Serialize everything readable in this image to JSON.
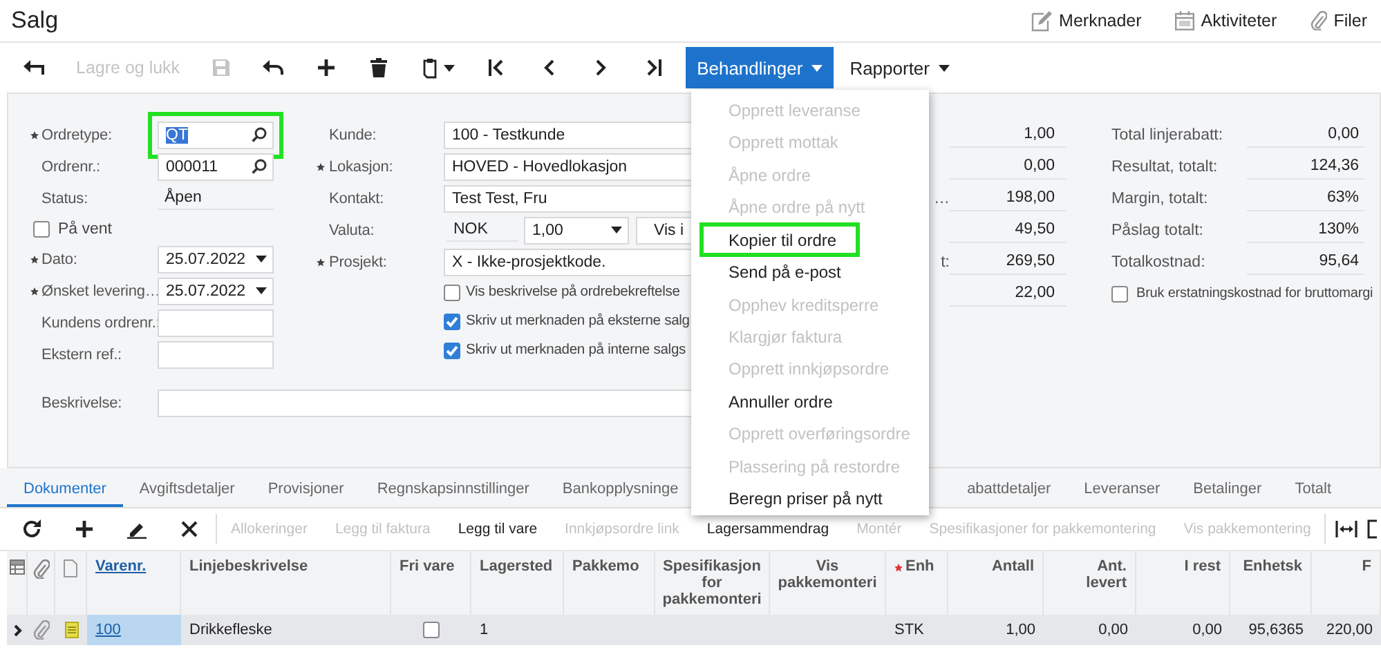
{
  "page_title": "Salg",
  "header_links": [
    {
      "kind": "notes",
      "label": "Merknader"
    },
    {
      "kind": "activities",
      "label": "Aktiviteter"
    },
    {
      "kind": "files",
      "label": "Filer"
    }
  ],
  "toolbar": [
    {
      "kind": "back",
      "disabled": false
    },
    {
      "kind": "text",
      "label": "Lagre og lukk",
      "disabled": true
    },
    {
      "kind": "save",
      "disabled": true
    },
    {
      "kind": "undo",
      "disabled": false
    },
    {
      "kind": "add",
      "disabled": false
    },
    {
      "kind": "delete",
      "disabled": false
    },
    {
      "kind": "clipboard",
      "disabled": false
    },
    {
      "kind": "first",
      "disabled": false
    },
    {
      "kind": "previous",
      "disabled": false
    },
    {
      "kind": "next",
      "disabled": false
    },
    {
      "kind": "last",
      "disabled": false
    }
  ],
  "menus": [
    {
      "label": "Behandlinger",
      "open": true,
      "items": [
        {
          "label": "Opprett leveranse",
          "disabled": true,
          "highlighted": false
        },
        {
          "label": "Opprett mottak",
          "disabled": true,
          "highlighted": false
        },
        {
          "label": "Åpne ordre",
          "disabled": true,
          "highlighted": false
        },
        {
          "label": "Åpne ordre på nytt",
          "disabled": true,
          "highlighted": false
        },
        {
          "label": "Kopier til ordre",
          "disabled": false,
          "highlighted": true
        },
        {
          "label": "Send på e-post",
          "disabled": false,
          "highlighted": false
        },
        {
          "label": "Opphev kreditsperre",
          "disabled": true,
          "highlighted": false
        },
        {
          "label": "Klargjør faktura",
          "disabled": true,
          "highlighted": false
        },
        {
          "label": "Opprett innkjøpsordre",
          "disabled": true,
          "highlighted": false
        },
        {
          "label": "Annuller ordre",
          "disabled": false,
          "highlighted": false
        },
        {
          "label": "Opprett overføringsordre",
          "disabled": true,
          "highlighted": false
        },
        {
          "label": "Plassering på restordre",
          "disabled": true,
          "highlighted": false
        },
        {
          "label": "Beregn priser på nytt",
          "disabled": false,
          "highlighted": false
        }
      ]
    },
    {
      "label": "Rapporter",
      "open": false
    }
  ],
  "form": {
    "left_fields": [
      {
        "kind": "lookup",
        "label": "Ordretype:",
        "required": true,
        "value": "QT",
        "value_selected": true,
        "highlighted": true
      },
      {
        "kind": "lookup",
        "label": "Ordrenr.:",
        "required": false,
        "value": "000011",
        "value_selected": false,
        "highlighted": false
      },
      {
        "kind": "readonly",
        "label": "Status:",
        "required": false,
        "value": "Åpen",
        "value_selected": false,
        "highlighted": false
      },
      {
        "kind": "checkbox",
        "label": "På vent",
        "checked": false,
        "highlighted": false
      },
      {
        "kind": "date",
        "label": "Dato:",
        "required": true,
        "value": "25.07.2022",
        "value_selected": false,
        "highlighted": false
      },
      {
        "kind": "date",
        "label": "Ønsket levering…",
        "required": true,
        "value": "25.07.2022",
        "value_selected": false,
        "highlighted": false
      },
      {
        "kind": "text",
        "label": "Kundens ordrenr.:",
        "required": false,
        "highlighted": false
      },
      {
        "kind": "text",
        "label": "Ekstern ref.:",
        "required": false,
        "highlighted": false
      }
    ],
    "middle_fields": [
      {
        "kind": "wide",
        "label": "Kunde:",
        "required": false,
        "value": "100 - Testkunde"
      },
      {
        "kind": "wide",
        "label": "Lokasjon:",
        "required": true,
        "value": "HOVED - Hovedlokasjon"
      },
      {
        "kind": "wide",
        "label": "Kontakt:",
        "required": false,
        "value": "Test Test, Fru"
      },
      {
        "kind": "currency",
        "label": "Valuta:",
        "required": false,
        "value": "NOK",
        "rate": "1,00",
        "button": "Vis i"
      },
      {
        "kind": "wide",
        "label": "Prosjekt:",
        "required": true,
        "value": "X - Ikke-prosjektkode."
      },
      {
        "kind": "checkbox",
        "label": "Vis beskrivelse på ordrebekreftelse",
        "checked": false
      },
      {
        "kind": "checkbox",
        "label": "Skriv ut merknaden på eksterne salg",
        "checked": true
      },
      {
        "kind": "checkbox",
        "label": "Skriv ut merknaden på interne salgs",
        "checked": true
      }
    ],
    "description": {
      "label": "Beskrivelse:"
    }
  },
  "summary": {
    "middle": [
      {
        "value": "1,00"
      },
      {
        "value": "0,00"
      },
      {
        "label": "…",
        "value": "198,00"
      },
      {
        "value": "49,50"
      },
      {
        "label": "t:",
        "value": "269,50"
      },
      {
        "value": "22,00"
      }
    ],
    "right": [
      {
        "label": "Total linjerabatt:",
        "value": "0,00"
      },
      {
        "label": "Resultat, totalt:",
        "value": "124,36"
      },
      {
        "label": "Margin, totalt:",
        "value": "63%"
      },
      {
        "label": "Påslag totalt:",
        "value": "130%"
      },
      {
        "label": "Totalkostnad:",
        "value": "95,64"
      }
    ],
    "right_checkbox": {
      "label": "Bruk erstatningskostnad for bruttomargi",
      "checked": false
    }
  },
  "tabs": [
    {
      "label": "Dokumenter",
      "selected": true
    },
    {
      "label": "Avgiftsdetaljer",
      "selected": false
    },
    {
      "label": "Provisjoner",
      "selected": false
    },
    {
      "label": "Regnskapsinnstillinger",
      "selected": false
    },
    {
      "label": "Bankopplysninge",
      "selected": false
    },
    {
      "label": "abattdetaljer",
      "selected": false
    },
    {
      "label": "Leveranser",
      "selected": false
    },
    {
      "label": "Betalinger",
      "selected": false
    },
    {
      "label": "Totalt",
      "selected": false
    }
  ],
  "grid_toolbar": [
    {
      "kind": "refresh",
      "disabled": false
    },
    {
      "kind": "add",
      "disabled": false
    },
    {
      "kind": "edit",
      "disabled": false
    },
    {
      "kind": "delete",
      "disabled": false
    },
    {
      "kind": "text",
      "label": "Allokeringer",
      "disabled": true
    },
    {
      "kind": "text",
      "label": "Legg til faktura",
      "disabled": true
    },
    {
      "kind": "text",
      "label": "Legg til vare",
      "disabled": false
    },
    {
      "kind": "text",
      "label": "Innkjøpsordre link",
      "disabled": true
    },
    {
      "kind": "text",
      "label": "Lagersammendrag",
      "disabled": false
    },
    {
      "kind": "text",
      "label": "Montér",
      "disabled": true
    },
    {
      "kind": "text",
      "label": "Spesifikasjoner for pakkemontering",
      "disabled": true
    },
    {
      "kind": "text",
      "label": "Vis pakkemontering",
      "disabled": true
    },
    {
      "kind": "fit",
      "disabled": false
    },
    {
      "kind": "square",
      "disabled": false
    }
  ],
  "grid": {
    "columns": [
      {
        "kind": "selector"
      },
      {
        "kind": "files"
      },
      {
        "kind": "notes"
      },
      {
        "kind": "link",
        "label": "Varenr.",
        "required": false
      },
      {
        "kind": "text",
        "label": "Linjebeskrivelse",
        "required": false
      },
      {
        "kind": "checkbox",
        "label": "Fri vare",
        "required": false
      },
      {
        "kind": "text",
        "label": "Lagersted",
        "required": false
      },
      {
        "kind": "text",
        "label": "Pakkemo",
        "required": false
      },
      {
        "kind": "center",
        "label": "Spesifikasjon for pakkemonteri",
        "required": false
      },
      {
        "kind": "center",
        "label": "Vis pakkemonteri",
        "required": false
      },
      {
        "kind": "text",
        "label": "Enh",
        "required": true
      },
      {
        "kind": "number",
        "label": "Antall",
        "required": false
      },
      {
        "kind": "number",
        "label": "Ant. levert",
        "required": false
      },
      {
        "kind": "number",
        "label": "I rest",
        "required": false
      },
      {
        "kind": "number",
        "label": "Enhetsk",
        "required": false
      },
      {
        "kind": "number",
        "label": "F",
        "required": false
      }
    ],
    "rows": [
      {
        "selected": true,
        "cells": [
          null,
          null,
          {
            "present": true
          },
          {
            "text": "100",
            "active": true
          },
          {
            "text": "Drikkefleske",
            "active": false
          },
          {
            "checked": false
          },
          {
            "text": "1",
            "active": false
          },
          null,
          null,
          null,
          {
            "text": "STK",
            "active": false
          },
          {
            "text": "1,00",
            "active": false
          },
          {
            "text": "0,00",
            "active": false
          },
          {
            "text": "0,00",
            "active": false
          },
          {
            "text": "95,6365",
            "active": false
          },
          {
            "text": "220,00",
            "active": false
          }
        ]
      }
    ]
  }
}
